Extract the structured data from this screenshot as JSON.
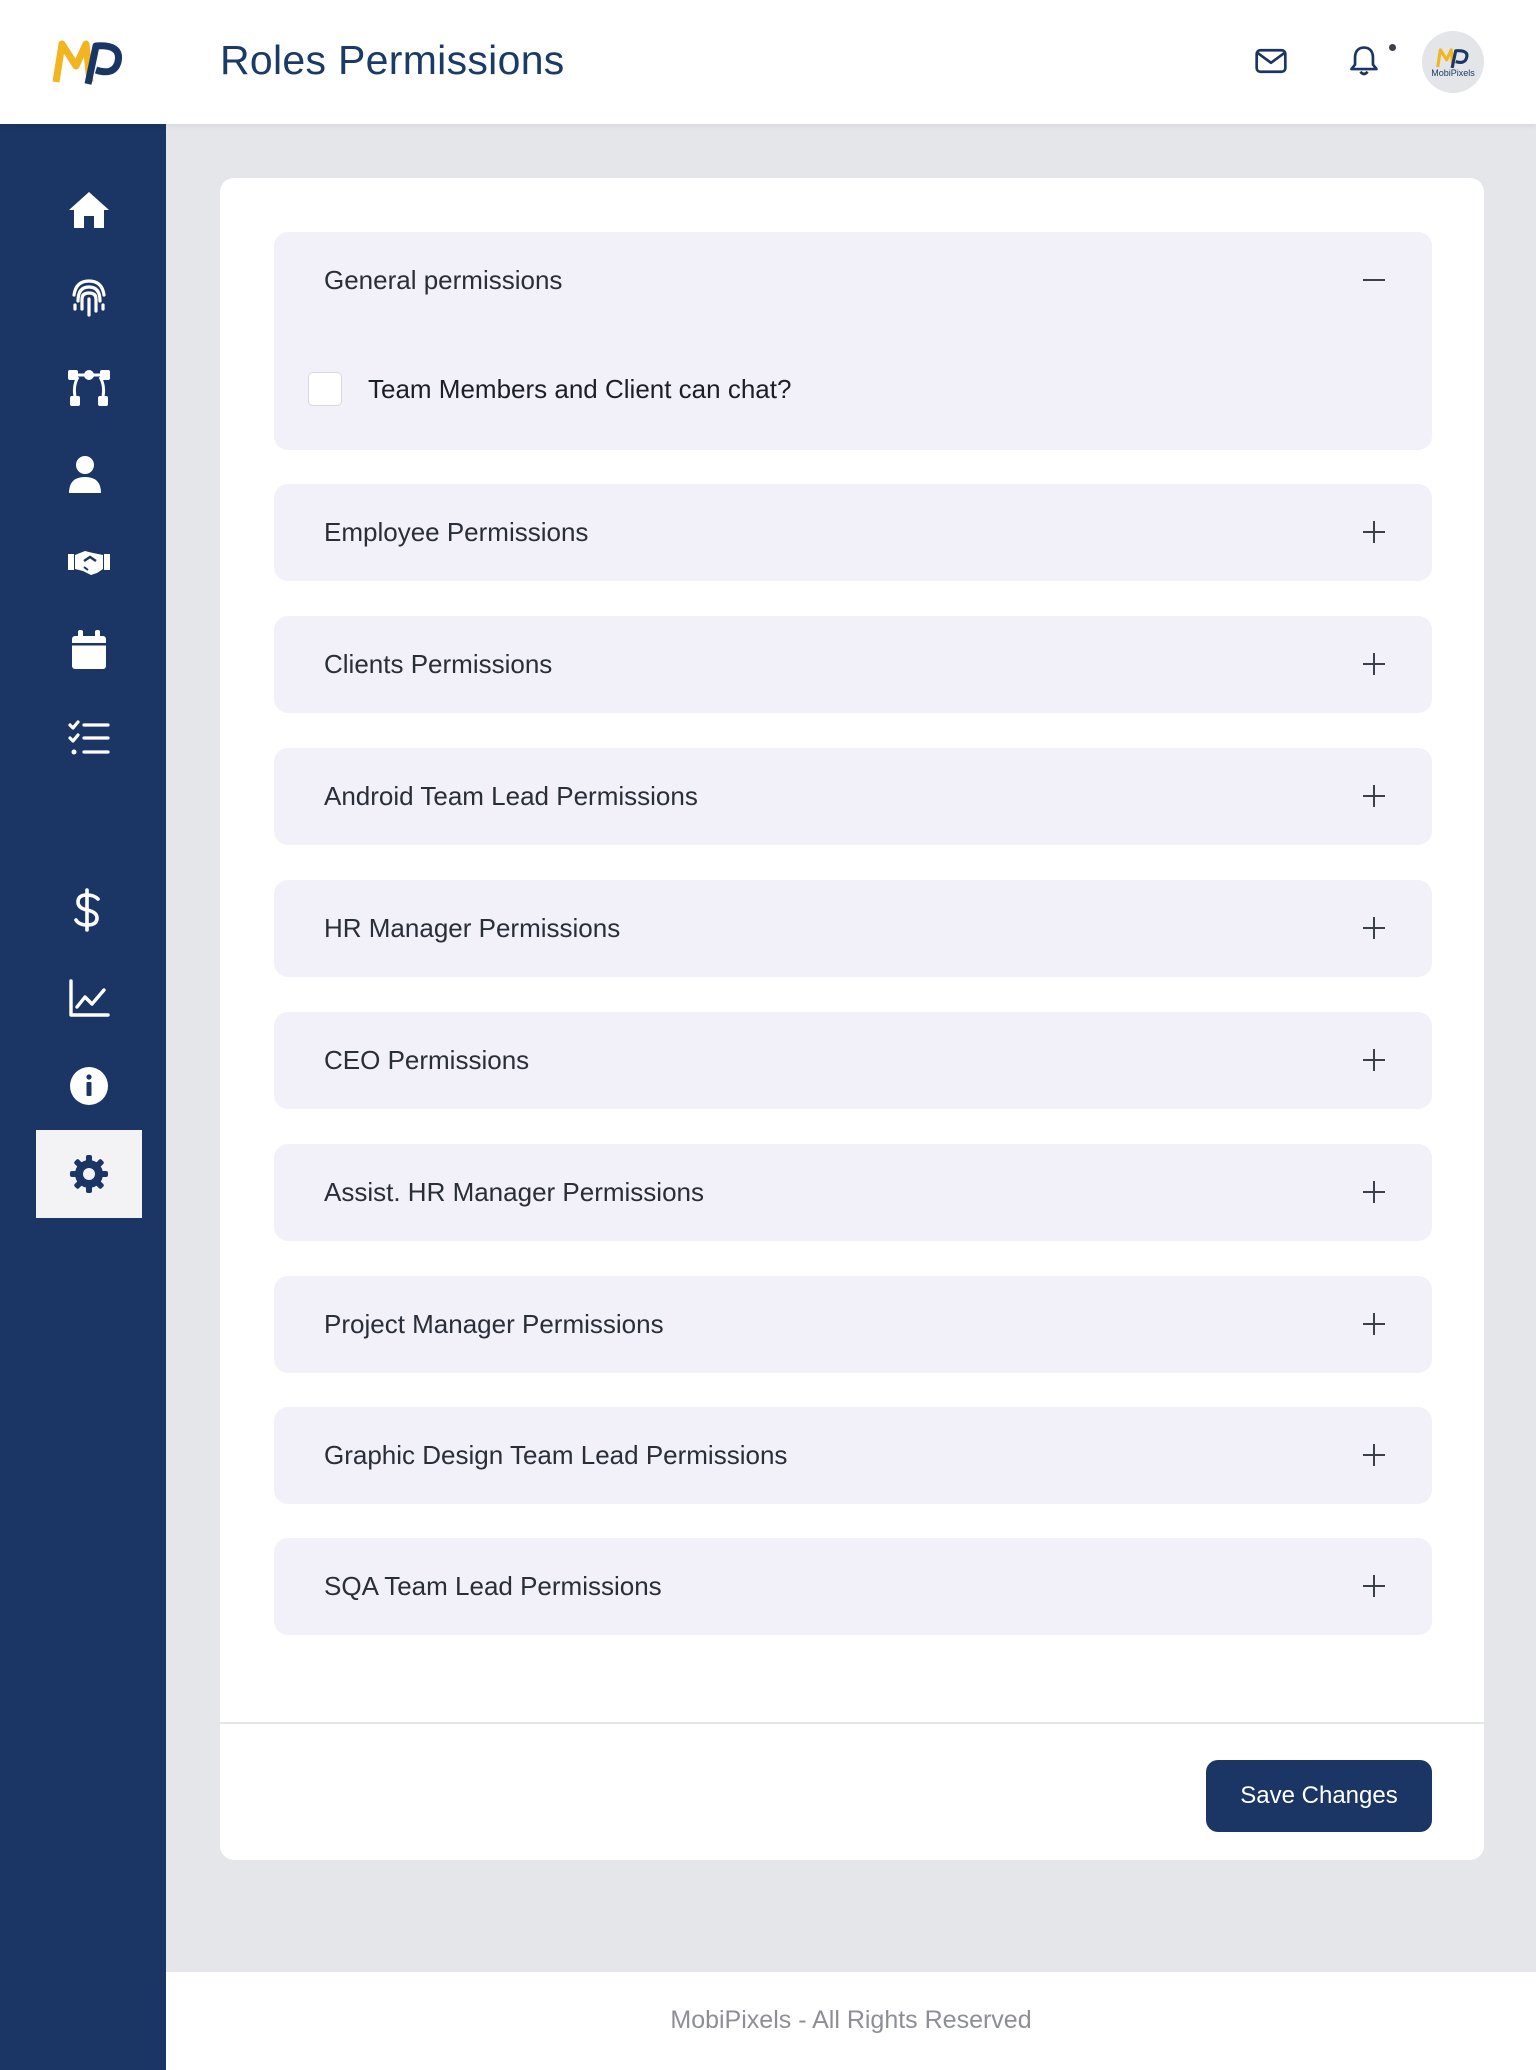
{
  "header": {
    "title": "Roles Permissions",
    "avatar_caption": "MobiPixels",
    "brand_colors": {
      "navy": "#1b3664",
      "gold": "#f2b41f"
    }
  },
  "sidebar": {
    "items": [
      {
        "icon": "home-icon",
        "active": false
      },
      {
        "icon": "fingerprint-icon",
        "active": false
      },
      {
        "icon": "vector-nodes-icon",
        "active": false
      },
      {
        "icon": "user-icon",
        "active": false
      },
      {
        "icon": "handshake-icon",
        "active": false
      },
      {
        "icon": "calendar-icon",
        "active": false
      },
      {
        "icon": "checklist-icon",
        "active": false
      },
      {
        "icon": "dollar-icon",
        "active": false
      },
      {
        "icon": "chart-line-icon",
        "active": false
      },
      {
        "icon": "info-icon",
        "active": false
      },
      {
        "icon": "gear-icon",
        "active": true
      }
    ]
  },
  "permissions": {
    "sections": [
      {
        "title": "General permissions",
        "expanded": true
      },
      {
        "title": "Employee Permissions",
        "expanded": false
      },
      {
        "title": "Clients Permissions",
        "expanded": false
      },
      {
        "title": "Android Team Lead Permissions",
        "expanded": false
      },
      {
        "title": "HR Manager Permissions",
        "expanded": false
      },
      {
        "title": "CEO Permissions",
        "expanded": false
      },
      {
        "title": "Assist. HR Manager Permissions",
        "expanded": false
      },
      {
        "title": "Project Manager Permissions",
        "expanded": false
      },
      {
        "title": "Graphic Design Team Lead Permissions",
        "expanded": false
      },
      {
        "title": "SQA Team Lead Permissions",
        "expanded": false
      }
    ],
    "general_options": [
      {
        "label": "Team Members and Client can chat?",
        "checked": false
      }
    ],
    "save_label": "Save Changes"
  },
  "footer": {
    "text": "MobiPixels - All Rights Reserved"
  }
}
